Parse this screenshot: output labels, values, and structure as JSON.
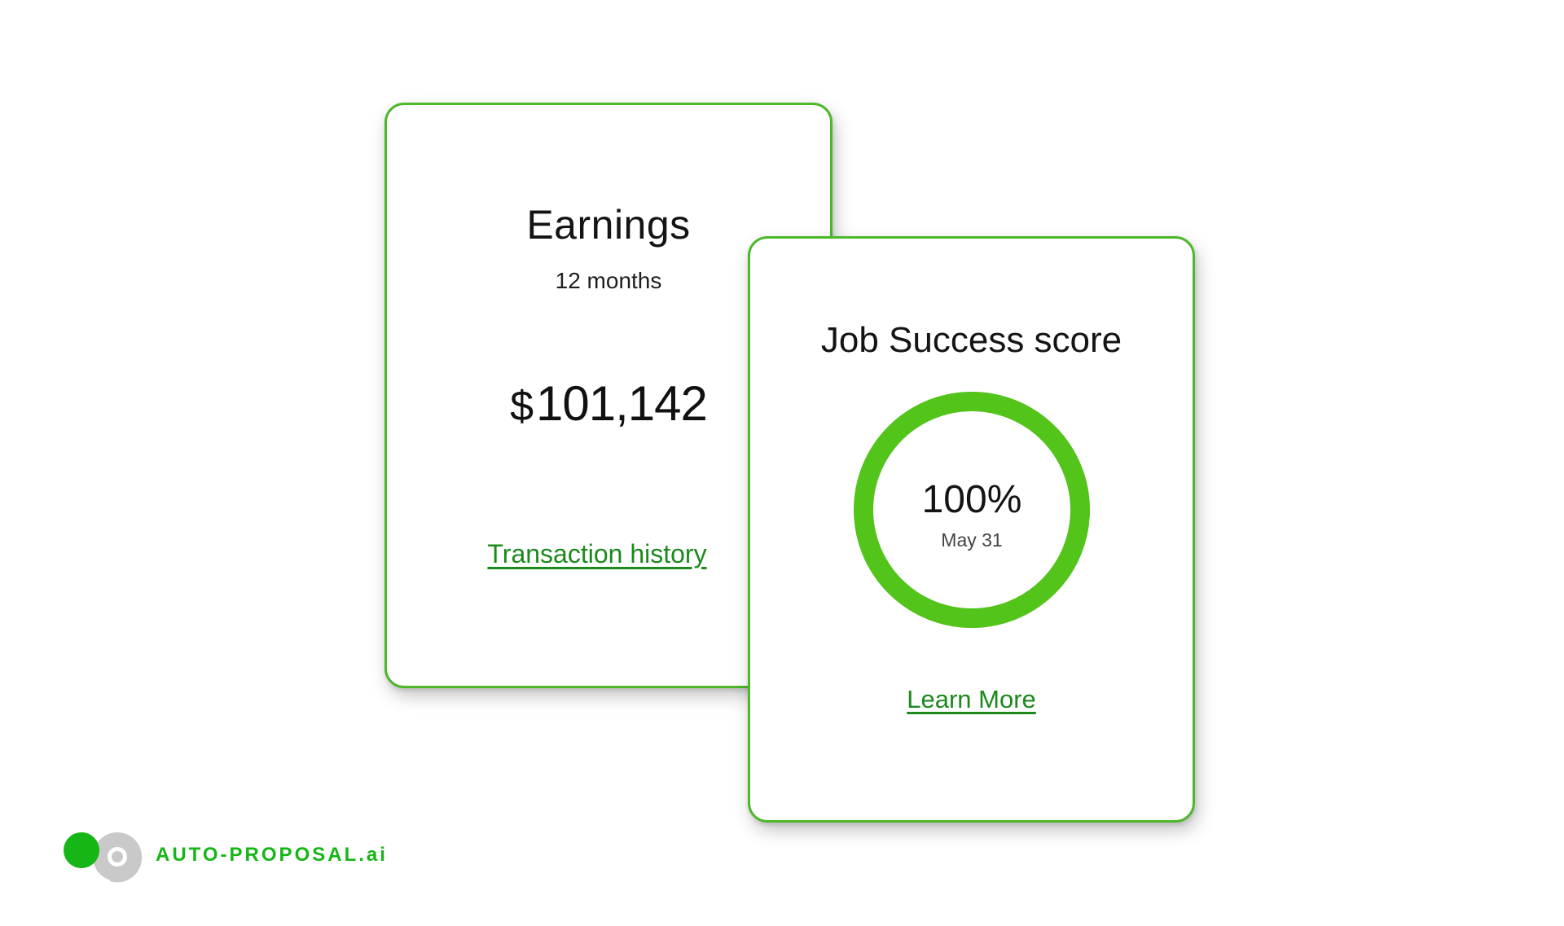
{
  "earnings_card": {
    "title": "Earnings",
    "period": "12 months",
    "currency": "$",
    "amount": "101,142",
    "link_label": "Transaction history"
  },
  "jss_card": {
    "title": "Job Success score",
    "score_label": "100%",
    "score_fraction": 1.0,
    "date": "May 31",
    "link_label": "Learn More"
  },
  "branding": {
    "logo_text": "AUTO-PROPOSAL.ai",
    "logo_icon": "auto-proposal-logo-icon"
  },
  "colors": {
    "accent_green": "#4cb82a",
    "ring_green": "#52c41a",
    "link_green": "#1b8a1b",
    "logo_green": "#16b616",
    "logo_gray": "#c9c9c9"
  }
}
